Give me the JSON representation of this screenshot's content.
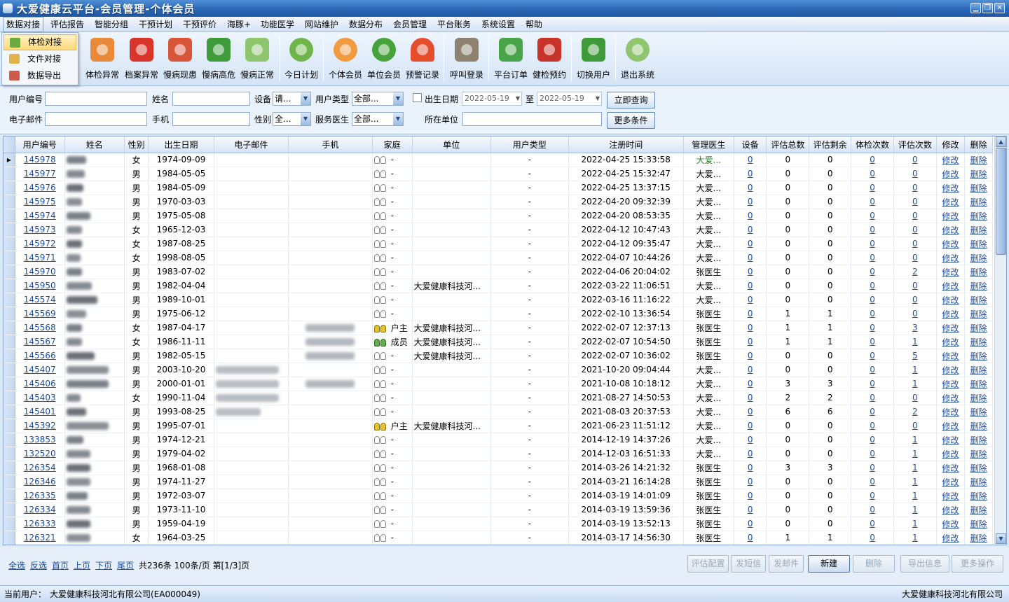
{
  "window": {
    "title": "大爱健康云平台-会员管理-个体会员",
    "buttons": [
      "▁",
      "❐",
      "✕"
    ]
  },
  "menu": [
    "数据对接",
    "评估报告",
    "智能分组",
    "干预计划",
    "干预评价",
    "海豚+",
    "功能医学",
    "网站维护",
    "数据分布",
    "会员管理",
    "平台账务",
    "系统设置",
    "帮助"
  ],
  "dropdown": [
    "体检对接",
    "文件对接",
    "数据导出"
  ],
  "toolbar": [
    {
      "label": "体检异常",
      "icon": "exam-abnormal-icon",
      "color": "#e88a3a"
    },
    {
      "label": "档案异常",
      "icon": "record-abnormal-icon",
      "color": "#d9342b"
    },
    {
      "label": "慢病现患",
      "icon": "chronic-current-icon",
      "color": "#d9553a"
    },
    {
      "label": "慢病高危",
      "icon": "chronic-risk-icon",
      "color": "#3f9b3a"
    },
    {
      "label": "慢病正常",
      "icon": "chronic-normal-icon",
      "color": "#8fc56f"
    },
    {
      "label": "今日计划",
      "icon": "clock-icon",
      "color": "#6fb54b"
    },
    {
      "label": "个体会员",
      "icon": "person-icon",
      "color": "#f19a3e"
    },
    {
      "label": "单位会员",
      "icon": "group-icon",
      "color": "#46a23b"
    },
    {
      "label": "预警记录",
      "icon": "bell-icon",
      "color": "#e64d2a"
    },
    {
      "label": "呼叫登录",
      "icon": "phone-icon",
      "color": "#8d8170"
    },
    {
      "label": "平台订单",
      "icon": "cart-icon",
      "color": "#4aa54a"
    },
    {
      "label": "健检预约",
      "icon": "medkit-icon",
      "color": "#c9342a"
    },
    {
      "label": "切换用户",
      "icon": "switch-user-icon",
      "color": "#3f9b3a"
    },
    {
      "label": "退出系统",
      "icon": "power-icon",
      "color": "#8fc56f"
    }
  ],
  "search": {
    "user_id_label": "用户编号",
    "name_label": "姓名",
    "device_label": "设备",
    "device_value": "请...",
    "user_type_label": "用户类型",
    "user_type_value": "全部...",
    "dob_label": "出生日期",
    "date_from": "2022-05-19",
    "to_label": "至",
    "date_to": "2022-05-19",
    "query_button": "立即查询",
    "email_label": "电子邮件",
    "phone_label": "手机",
    "gender_label": "性别",
    "gender_value": "全...",
    "doctor_label": "服务医生",
    "doctor_value": "全部...",
    "org_label": "所在单位",
    "more_button": "更多条件"
  },
  "grid": {
    "columns": [
      "用户编号",
      "姓名",
      "性别",
      "出生日期",
      "电子邮件",
      "手机",
      "家庭",
      "单位",
      "用户类型",
      "注册时间",
      "管理医生",
      "设备",
      "评估总数",
      "评估剩余",
      "体检次数",
      "评估次数",
      "修改",
      "删除"
    ],
    "rows": [
      [
        "145978",
        "女",
        "1974-09-09",
        "-",
        "",
        "-",
        "2022-04-25 15:33:58",
        "大爱...",
        "0",
        "0",
        "0",
        "0",
        "0",
        "",
        ""
      ],
      [
        "145977",
        "男",
        "1984-05-05",
        "-",
        "",
        "-",
        "2022-04-25 15:32:47",
        "大爱...",
        "0",
        "0",
        "0",
        "0",
        "0",
        "",
        ""
      ],
      [
        "145976",
        "男",
        "1984-05-09",
        "-",
        "",
        "-",
        "2022-04-25 13:37:15",
        "大爱...",
        "0",
        "0",
        "0",
        "0",
        "0",
        "",
        ""
      ],
      [
        "145975",
        "男",
        "1970-03-03",
        "-",
        "",
        "-",
        "2022-04-20 09:32:39",
        "大爱...",
        "0",
        "0",
        "0",
        "0",
        "0",
        "",
        ""
      ],
      [
        "145974",
        "男",
        "1975-05-08",
        "-",
        "",
        "-",
        "2022-04-20 08:53:35",
        "大爱...",
        "0",
        "0",
        "0",
        "0",
        "0",
        "",
        ""
      ],
      [
        "145973",
        "女",
        "1965-12-03",
        "-",
        "",
        "-",
        "2022-04-12 10:47:43",
        "大爱...",
        "0",
        "0",
        "0",
        "0",
        "0",
        "",
        ""
      ],
      [
        "145972",
        "女",
        "1987-08-25",
        "-",
        "",
        "-",
        "2022-04-12 09:35:47",
        "大爱...",
        "0",
        "0",
        "0",
        "0",
        "0",
        "",
        ""
      ],
      [
        "145971",
        "女",
        "1998-08-05",
        "-",
        "",
        "-",
        "2022-04-07 10:44:26",
        "大爱...",
        "0",
        "0",
        "0",
        "0",
        "0",
        "",
        ""
      ],
      [
        "145970",
        "男",
        "1983-07-02",
        "-",
        "",
        "-",
        "2022-04-06 20:04:02",
        "张医生",
        "0",
        "0",
        "0",
        "0",
        "2",
        "",
        ""
      ],
      [
        "145950",
        "男",
        "1982-04-04",
        "-",
        "大爱健康科技河...",
        "-",
        "2022-03-22 11:06:51",
        "大爱...",
        "0",
        "0",
        "0",
        "0",
        "0",
        "",
        ""
      ],
      [
        "145574",
        "男",
        "1989-10-01",
        "-",
        "",
        "-",
        "2022-03-16 11:16:22",
        "大爱...",
        "0",
        "0",
        "0",
        "0",
        "0",
        "",
        ""
      ],
      [
        "145569",
        "男",
        "1975-06-12",
        "-",
        "",
        "-",
        "2022-02-10 13:36:54",
        "张医生",
        "0",
        "1",
        "1",
        "0",
        "0",
        "",
        ""
      ],
      [
        "145568",
        "女",
        "1987-04-17",
        "户主",
        "大爱健康科技河...",
        "-",
        "2022-02-07 12:37:13",
        "张医生",
        "0",
        "1",
        "1",
        "0",
        "3",
        "y",
        "y"
      ],
      [
        "145567",
        "女",
        "1986-11-11",
        "成员",
        "大爱健康科技河...",
        "-",
        "2022-02-07 10:54:50",
        "张医生",
        "0",
        "1",
        "1",
        "0",
        "1",
        "g",
        "g"
      ],
      [
        "145566",
        "男",
        "1982-05-15",
        "-",
        "大爱健康科技河...",
        "-",
        "2022-02-07 10:36:02",
        "张医生",
        "0",
        "0",
        "0",
        "0",
        "5",
        "",
        ""
      ],
      [
        "145407",
        "男",
        "2003-10-20",
        "-",
        "",
        "-",
        "2021-10-20 09:04:44",
        "大爱...",
        "0",
        "0",
        "0",
        "0",
        "1",
        "",
        ""
      ],
      [
        "145406",
        "男",
        "2000-01-01",
        "-",
        "",
        "-",
        "2021-10-08 10:18:12",
        "大爱...",
        "0",
        "3",
        "3",
        "0",
        "1",
        "",
        ""
      ],
      [
        "145403",
        "女",
        "1990-11-04",
        "-",
        "",
        "-",
        "2021-08-27 14:50:53",
        "大爱...",
        "0",
        "2",
        "2",
        "0",
        "0",
        "",
        ""
      ],
      [
        "145401",
        "男",
        "1993-08-25",
        "-",
        "",
        "-",
        "2021-08-03 20:37:53",
        "大爱...",
        "0",
        "6",
        "6",
        "0",
        "2",
        "",
        ""
      ],
      [
        "145392",
        "男",
        "1995-07-01",
        "户主",
        "大爱健康科技河...",
        "-",
        "2021-06-23 11:51:12",
        "大爱...",
        "0",
        "0",
        "0",
        "0",
        "0",
        "y",
        "y"
      ],
      [
        "133853",
        "男",
        "1974-12-21",
        "-",
        "",
        "-",
        "2014-12-19 14:37:26",
        "大爱...",
        "0",
        "0",
        "0",
        "0",
        "1",
        "",
        ""
      ],
      [
        "132520",
        "男",
        "1979-04-02",
        "-",
        "",
        "-",
        "2014-12-03 16:51:33",
        "大爱...",
        "0",
        "0",
        "0",
        "0",
        "1",
        "",
        ""
      ],
      [
        "126354",
        "男",
        "1968-01-08",
        "-",
        "",
        "-",
        "2014-03-26 14:21:32",
        "张医生",
        "0",
        "3",
        "3",
        "0",
        "1",
        "",
        ""
      ],
      [
        "126346",
        "男",
        "1974-11-27",
        "-",
        "",
        "-",
        "2014-03-21 16:14:28",
        "张医生",
        "0",
        "0",
        "0",
        "0",
        "1",
        "",
        ""
      ],
      [
        "126335",
        "男",
        "1972-03-07",
        "-",
        "",
        "-",
        "2014-03-19 14:01:09",
        "张医生",
        "0",
        "0",
        "0",
        "0",
        "1",
        "",
        ""
      ],
      [
        "126334",
        "男",
        "1973-11-10",
        "-",
        "",
        "-",
        "2014-03-19 13:59:36",
        "张医生",
        "0",
        "0",
        "0",
        "0",
        "1",
        "",
        ""
      ],
      [
        "126333",
        "男",
        "1959-04-19",
        "-",
        "",
        "-",
        "2014-03-19 13:52:13",
        "张医生",
        "0",
        "0",
        "0",
        "0",
        "1",
        "",
        ""
      ],
      [
        "126321",
        "女",
        "1964-03-25",
        "-",
        "",
        "-",
        "2014-03-17 14:56:30",
        "张医生",
        "0",
        "1",
        "1",
        "0",
        "1",
        "",
        ""
      ]
    ],
    "edit_label": "修改",
    "delete_label": "删除",
    "row_pointer": "▸"
  },
  "pager": {
    "select_all": "全选",
    "invert": "反选",
    "first": "首页",
    "prev": "上页",
    "next": "下页",
    "last": "尾页",
    "summary": "共236条 100条/页 第[1/3]页"
  },
  "actions": [
    "评估配置",
    "发短信",
    "发邮件",
    "新建",
    "删除",
    "导出信息",
    "更多操作"
  ],
  "status": {
    "current_user_label": "当前用户：",
    "current_user": "大爱健康科技河北有限公司(EA000049)",
    "company": "大爱健康科技河北有限公司"
  },
  "colors": {
    "titlebar": "#2a66b4",
    "link": "#1f4fa0",
    "doctor_green": "#2d7d2d"
  }
}
